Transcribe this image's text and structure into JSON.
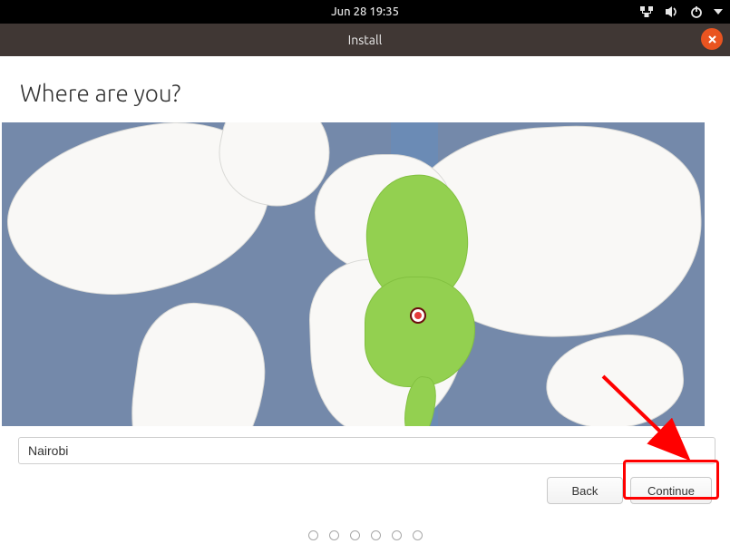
{
  "topbar": {
    "datetime": "Jun 28  19:35"
  },
  "window": {
    "title": "Install"
  },
  "page": {
    "heading": "Where are you?",
    "location_value": "Nairobi"
  },
  "buttons": {
    "back": "Back",
    "continue": "Continue"
  },
  "icons": {
    "network": "network-wired",
    "sound": "volume",
    "power": "power",
    "dropdown": "chevron-down",
    "close": "close"
  },
  "timezone": {
    "selected_location": "Nairobi"
  }
}
